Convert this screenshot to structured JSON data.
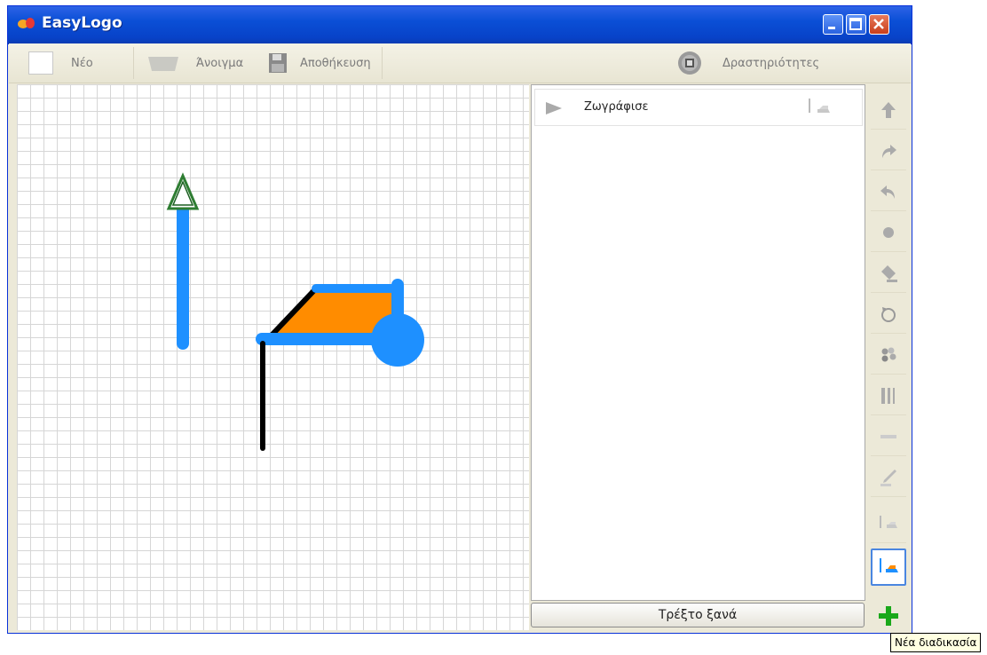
{
  "window": {
    "title": "EasyLogo",
    "controls": [
      "minimize-icon",
      "maximize-icon",
      "close-icon"
    ]
  },
  "toolbar": {
    "new_label": "Νέο",
    "open_label": "Άνοιγμα",
    "save_label": "Αποθήκευση",
    "activities_label": "Δραστηριότητες"
  },
  "procedures": {
    "items": [
      {
        "label": "Ζωγράφισε",
        "icon": "play-icon",
        "flag_icon": "flag-icon"
      }
    ]
  },
  "run_button": {
    "label": "Τρέξτο ξανά"
  },
  "commands": [
    {
      "name": "forward",
      "icon": "arrow-up-icon"
    },
    {
      "name": "turn-right",
      "icon": "turn-right-icon"
    },
    {
      "name": "turn-left",
      "icon": "turn-left-icon"
    },
    {
      "name": "dot",
      "icon": "dot-icon"
    },
    {
      "name": "fill",
      "icon": "fill-bucket-icon"
    },
    {
      "name": "repeat",
      "icon": "repeat-icon"
    },
    {
      "name": "color",
      "icon": "palette-icon"
    },
    {
      "name": "pen-width",
      "icon": "pen-width-icon"
    },
    {
      "name": "pen-up",
      "icon": "pen-up-icon"
    },
    {
      "name": "pen-down",
      "icon": "pen-down-icon"
    },
    {
      "name": "procedure",
      "icon": "flag-icon"
    },
    {
      "name": "new-procedure-flag",
      "icon": "flag-color-icon"
    }
  ],
  "add_button": {
    "icon": "plus-icon"
  },
  "tooltip": {
    "text": "Νέα διαδικασία"
  },
  "colors": {
    "stroke_blue": "#1e90ff",
    "fill_orange": "#ff8c00",
    "line_black": "#000000",
    "turtle_green": "#2e7d32",
    "add_green": "#1aa81a"
  }
}
